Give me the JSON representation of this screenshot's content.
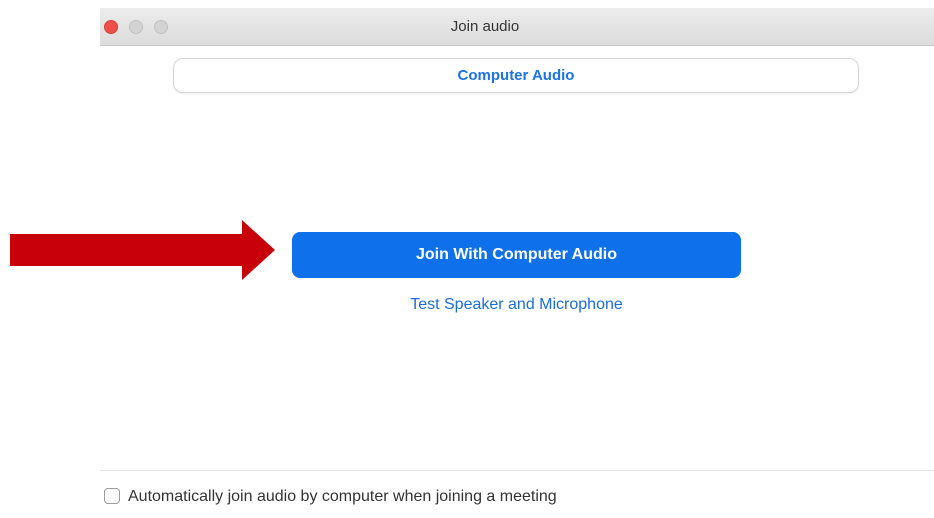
{
  "window": {
    "title": "Join audio",
    "controls": [
      "close",
      "minimize",
      "maximize"
    ]
  },
  "tabs": [
    {
      "label": "Computer Audio",
      "selected": true
    }
  ],
  "main": {
    "join_button_label": "Join With Computer Audio",
    "test_link_label": "Test Speaker and Microphone"
  },
  "footer": {
    "auto_join_label": "Automatically join audio by computer when joining a meeting",
    "auto_join_checked": false
  },
  "colors": {
    "accent": "#0e71eb",
    "link": "#1a6ee0",
    "annotation_arrow": "#c8000a"
  }
}
